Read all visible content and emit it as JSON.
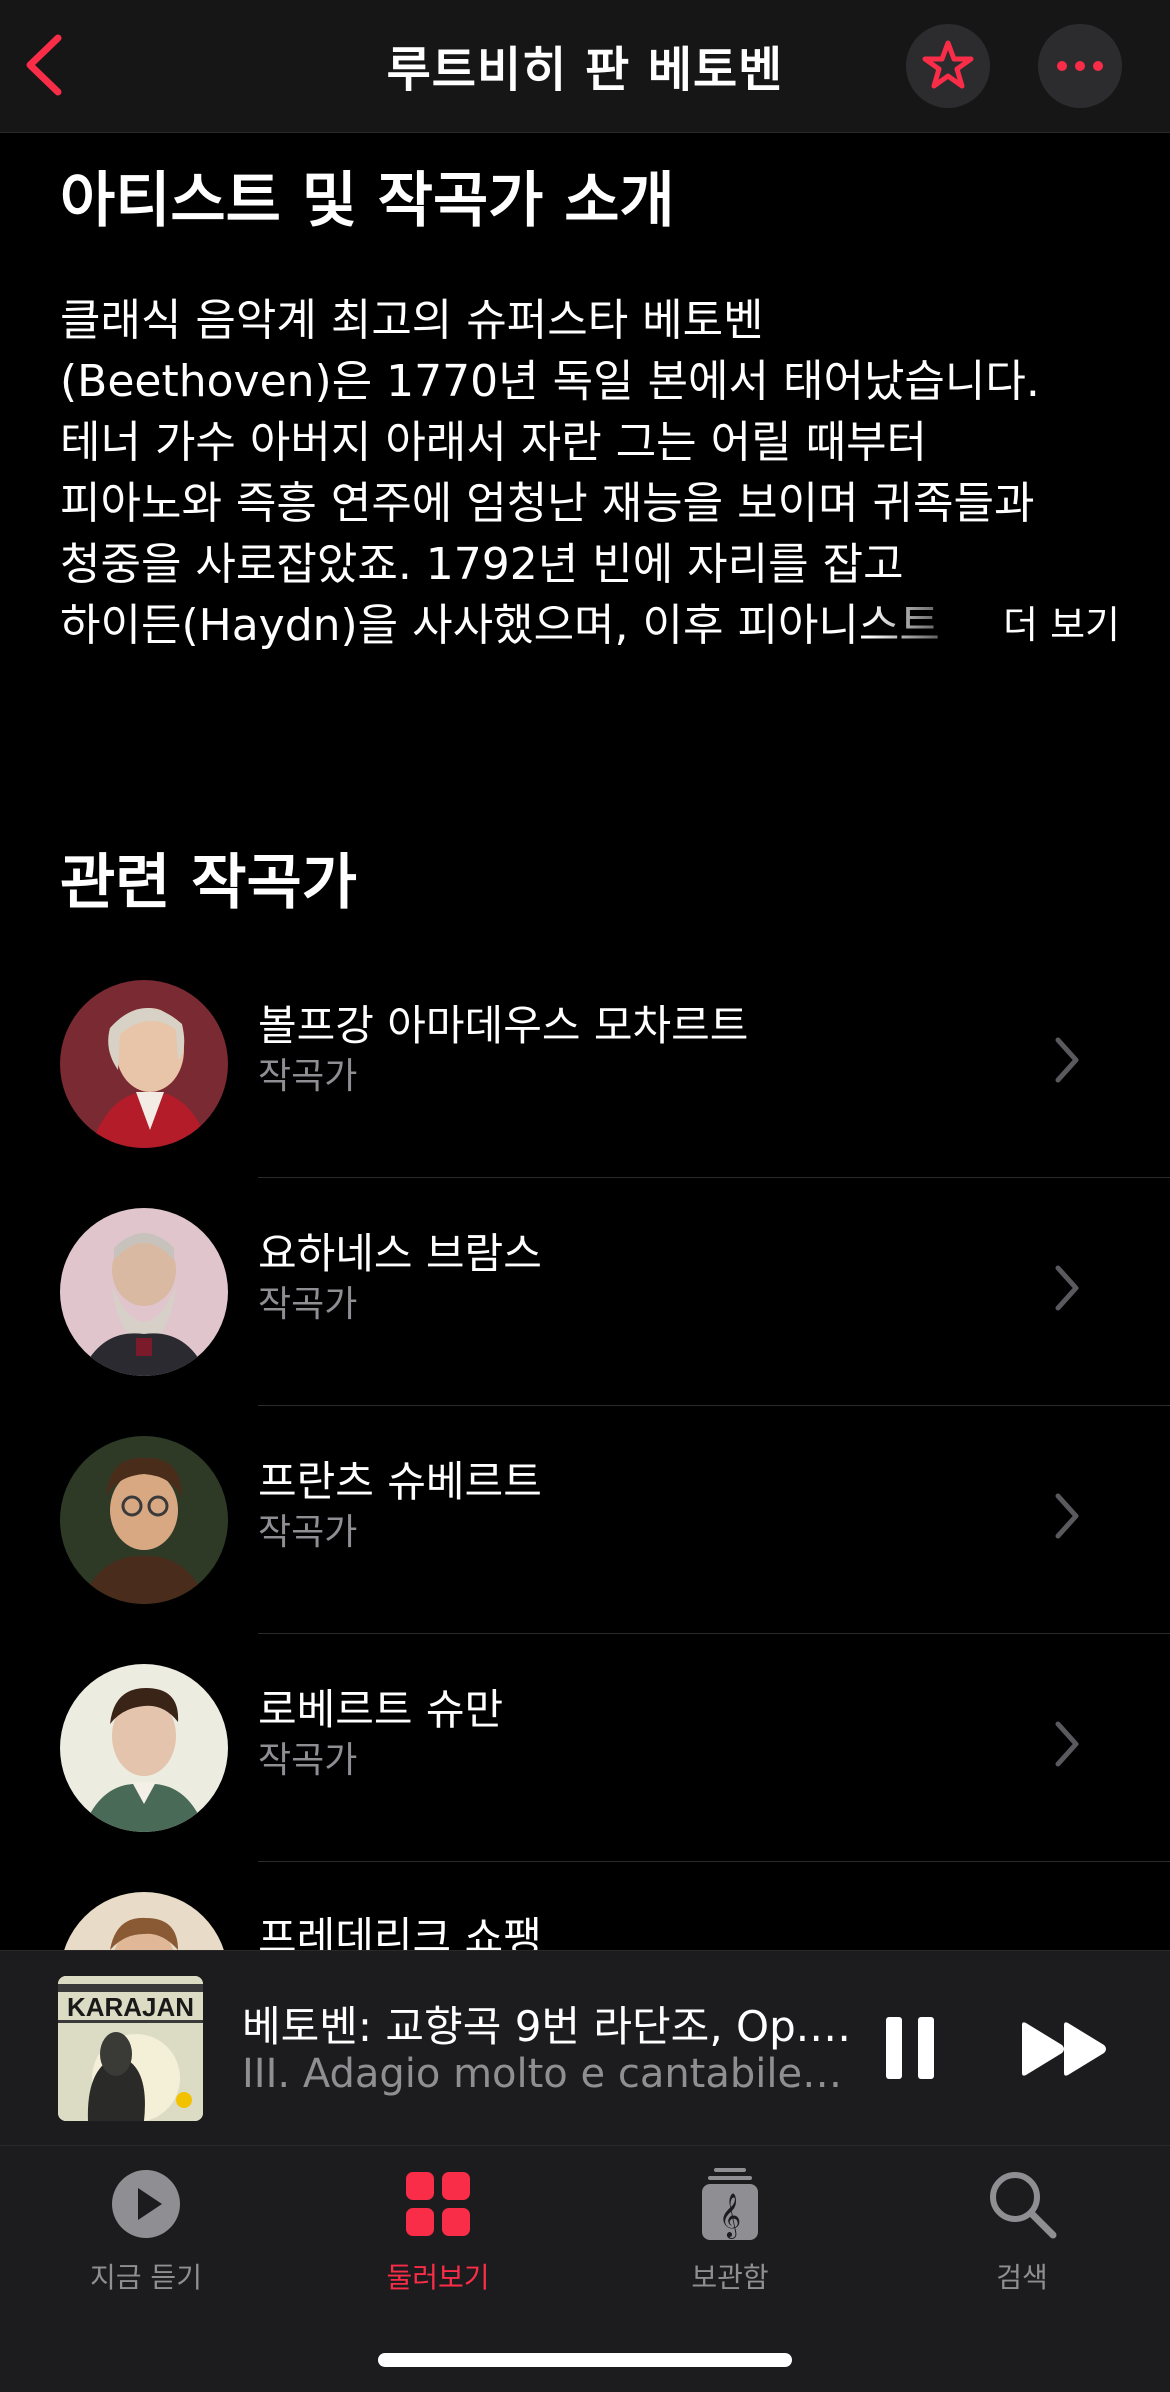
{
  "header": {
    "title": "루트비히 판 베토벤",
    "back_icon": "chevron-left-icon",
    "favorite_icon": "star-icon",
    "more_icon": "ellipsis-icon"
  },
  "about": {
    "title": "아티스트 및 작곡가 소개",
    "lines": [
      "클래식 음악계 최고의 슈퍼스타 베토벤",
      "(Beethoven)은 1770년 독일 본에서 태어났습니다.",
      "테너 가수 아버지 아래서 자란 그는 어릴 때부터",
      "피아노와 즉흥 연주에 엄청난 재능을 보이며 귀족들과",
      "청중을 사로잡았죠. 1792년 빈에 자리를 잡고",
      "하이든(Haydn)을 사사했으며, 이후 피아니스트"
    ],
    "more_label": "더 보기"
  },
  "related": {
    "title": "관련 작곡가",
    "items": [
      {
        "name": "볼프강 아마데우스 모차르트",
        "role": "작곡가"
      },
      {
        "name": "요하네스 브람스",
        "role": "작곡가"
      },
      {
        "name": "프란츠 슈베르트",
        "role": "작곡가"
      },
      {
        "name": "로베르트 슈만",
        "role": "작곡가"
      },
      {
        "name": "프레데리크 쇼팽",
        "role": ""
      }
    ]
  },
  "now_playing": {
    "title": "베토벤: 교향곡 9번 라단조, Op.…",
    "subtitle": "III. Adagio molto e cantabile…",
    "album_text": "KARAJAN",
    "pause_icon": "pause-icon",
    "forward_icon": "fast-forward-icon"
  },
  "tabs": [
    {
      "label": "지금 듣기",
      "icon": "play-circle-icon",
      "active": false
    },
    {
      "label": "둘러보기",
      "icon": "grid-icon",
      "active": true
    },
    {
      "label": "보관함",
      "icon": "library-icon",
      "active": false
    },
    {
      "label": "검색",
      "icon": "search-icon",
      "active": false
    }
  ],
  "colors": {
    "accent": "#fa2d48",
    "background": "#000000",
    "secondary_text": "#8e8e93"
  }
}
